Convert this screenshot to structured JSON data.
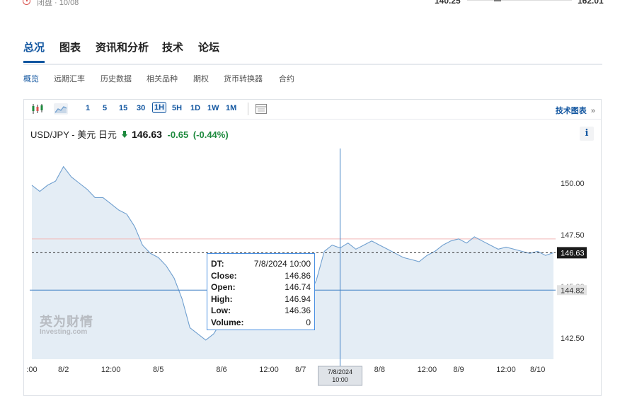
{
  "top": {
    "status": "闭盘 · 10/08",
    "range_low": "140.25",
    "range_high": "162.01",
    "range_position": 0.29
  },
  "main_tabs": [
    {
      "label": "总况",
      "active": true
    },
    {
      "label": "图表"
    },
    {
      "label": "资讯和分析"
    },
    {
      "label": "技术"
    },
    {
      "label": "论坛"
    }
  ],
  "sub_tabs": [
    {
      "label": "概览",
      "active": true
    },
    {
      "label": "远期汇率"
    },
    {
      "label": "历史数据"
    },
    {
      "label": "相关品种"
    },
    {
      "label": "期权"
    },
    {
      "label": "货币转换器"
    },
    {
      "label": "合约"
    }
  ],
  "toolbar": {
    "icons": [
      "candlestick-icon",
      "area-chart-icon"
    ],
    "intervals": [
      "1",
      "5",
      "15",
      "30",
      "1H",
      "5H",
      "1D",
      "1W",
      "1M"
    ],
    "active_interval": "1H",
    "table_icon": "table-icon",
    "tech_chart_label": "技术图表",
    "tech_chart_arrow": "»"
  },
  "quote": {
    "name": "USD/JPY - 美元 日元",
    "arrow": "🡇",
    "price": "146.63",
    "change": "-0.65",
    "change_pct": "(-0.44%)",
    "info_label": "i"
  },
  "colors": {
    "accent": "#1256a0",
    "line": "#6f9fcf",
    "fill": "#dde8f3",
    "down": "#1e8a3e"
  },
  "tooltip": {
    "rows": [
      {
        "k": "DT:",
        "v": "7/8/2024 10:00"
      },
      {
        "k": "Close:",
        "v": "146.86"
      },
      {
        "k": "Open:",
        "v": "146.74"
      },
      {
        "k": "High:",
        "v": "146.94"
      },
      {
        "k": "Low:",
        "v": "146.36"
      },
      {
        "k": "Volume:",
        "v": "0"
      }
    ]
  },
  "watermark": {
    "cn": "英为财情",
    "en": "Investing.com"
  },
  "chart_data": {
    "type": "area",
    "y_ticks": [
      "150.00",
      "147.50",
      "142.50"
    ],
    "y_hidden_tick": "145.00",
    "ylim": [
      141.5,
      153.0
    ],
    "x_ticks": [
      ":00",
      "8/2",
      "12:00",
      "8/5",
      "8/6",
      "12:00",
      "8/7",
      "8/8",
      "12:00",
      "8/9",
      "12:00",
      "8/10"
    ],
    "x_tick_index": [
      0,
      4,
      10,
      16,
      24,
      30,
      34,
      44,
      50,
      54,
      60,
      64
    ],
    "last_price_label": "146.63",
    "last_price": 146.63,
    "hline_price_label": "144.82",
    "hline_price": 144.82,
    "red_line_price": 147.3,
    "crosshair_label": [
      "7/8/2024",
      "10:00"
    ],
    "crosshair_index": 39,
    "values": [
      149.9,
      149.6,
      149.9,
      150.1,
      150.8,
      150.3,
      150.0,
      149.7,
      149.3,
      149.3,
      149.0,
      148.7,
      148.5,
      147.9,
      147.0,
      146.6,
      146.4,
      146.0,
      145.4,
      144.4,
      143.0,
      142.7,
      142.4,
      142.7,
      143.3,
      143.8,
      144.3,
      144.9,
      145.8,
      146.3,
      145.9,
      145.1,
      144.0,
      143.8,
      144.3,
      144.5,
      145.3,
      146.7,
      147.0,
      146.86,
      147.1,
      146.8,
      147.0,
      147.2,
      147.0,
      146.8,
      146.6,
      146.4,
      146.3,
      146.2,
      146.5,
      146.7,
      147.0,
      147.2,
      147.3,
      147.1,
      147.4,
      147.2,
      147.0,
      146.8,
      146.9,
      146.8,
      146.7,
      146.6,
      146.7,
      146.5,
      146.63
    ]
  }
}
